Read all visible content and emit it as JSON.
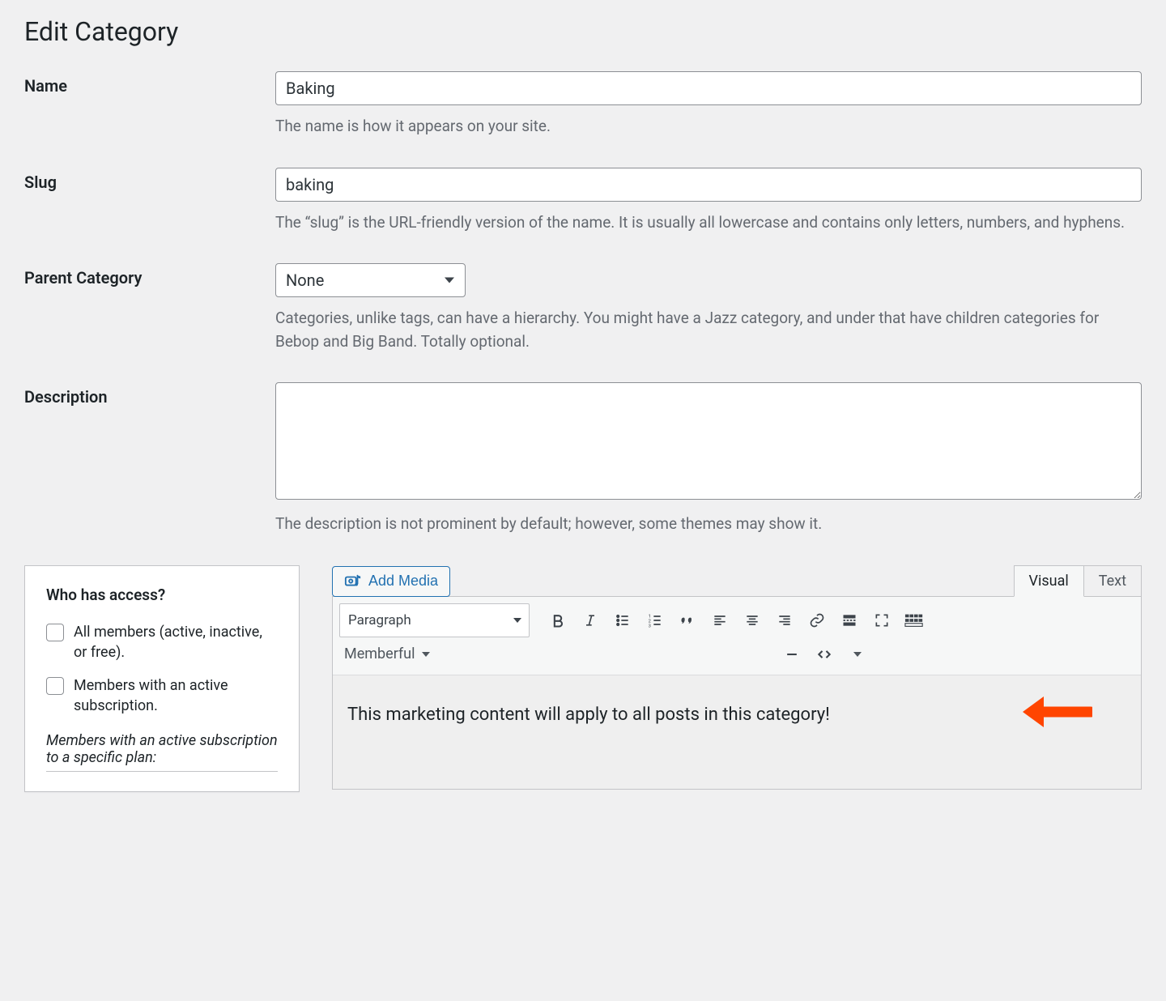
{
  "page_title": "Edit Category",
  "fields": {
    "name": {
      "label": "Name",
      "value": "Baking",
      "helper": "The name is how it appears on your site."
    },
    "slug": {
      "label": "Slug",
      "value": "baking",
      "helper": "The “slug” is the URL-friendly version of the name. It is usually all lowercase and contains only letters, numbers, and hyphens."
    },
    "parent": {
      "label": "Parent Category",
      "value": "None",
      "helper": "Categories, unlike tags, can have a hierarchy. You might have a Jazz category, and under that have children categories for Bebop and Big Band. Totally optional."
    },
    "description": {
      "label": "Description",
      "value": "",
      "helper": "The description is not prominent by default; however, some themes may show it."
    }
  },
  "access_box": {
    "heading": "Who has access?",
    "option_all": "All members (active, inactive, or free).",
    "option_active": "Members with an active subscription.",
    "plan_heading": "Members with an active subscription to a specific plan:"
  },
  "editor": {
    "add_media": "Add Media",
    "tab_visual": "Visual",
    "tab_text": "Text",
    "format_value": "Paragraph",
    "memberful_label": "Memberful",
    "content": "This marketing content will apply to all posts in this category!"
  }
}
